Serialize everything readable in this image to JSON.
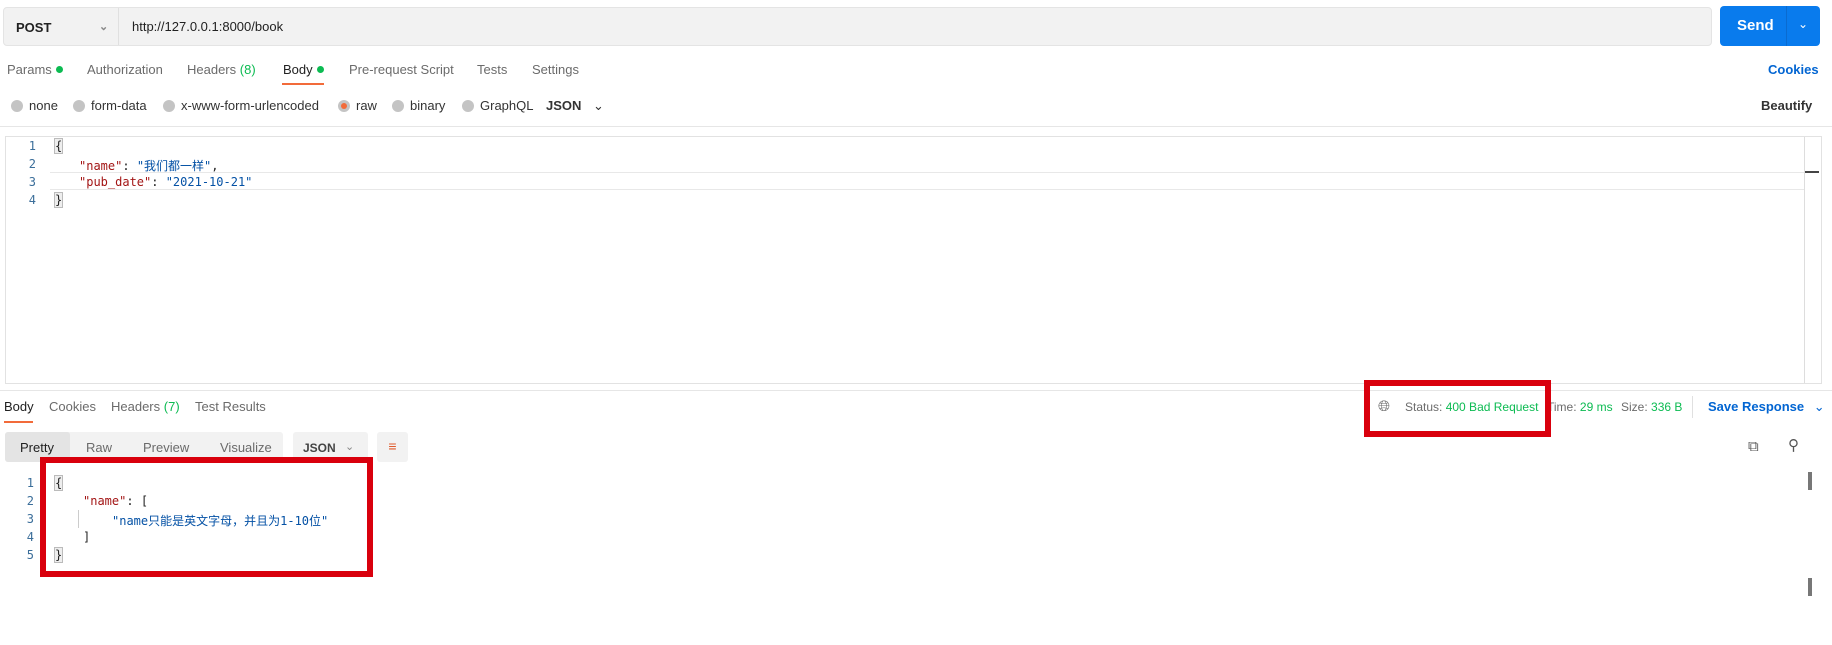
{
  "request": {
    "method": "POST",
    "url": "http://127.0.0.1:8000/book",
    "send_label": "Send"
  },
  "tabs": [
    {
      "label": "Params",
      "dot": true
    },
    {
      "label": "Authorization"
    },
    {
      "label": "Headers",
      "count": "(8)"
    },
    {
      "label": "Body",
      "dot": true,
      "active": true
    },
    {
      "label": "Pre-request Script"
    },
    {
      "label": "Tests"
    },
    {
      "label": "Settings"
    }
  ],
  "cookies_label": "Cookies",
  "body_types": [
    {
      "label": "none"
    },
    {
      "label": "form-data"
    },
    {
      "label": "x-www-form-urlencoded"
    },
    {
      "label": "raw",
      "selected": true
    },
    {
      "label": "binary"
    },
    {
      "label": "GraphQL"
    }
  ],
  "body_format": "JSON",
  "beautify_label": "Beautify",
  "request_body": {
    "line_numbers": [
      "1",
      "2",
      "3",
      "4"
    ],
    "open": "{",
    "close": "}",
    "k1": "\"name\"",
    "v1": "\"我们都一样\"",
    "k2": "\"pub_date\"",
    "v2": "\"2021-10-21\""
  },
  "response": {
    "tabs": [
      {
        "label": "Body",
        "active": true
      },
      {
        "label": "Cookies"
      },
      {
        "label": "Headers",
        "count": "(7)"
      },
      {
        "label": "Test Results"
      }
    ],
    "status_label": "Status:",
    "status_value": "400 Bad Request",
    "time_label": "Time:",
    "time_value": "29 ms",
    "size_label": "Size:",
    "size_value": "336 B",
    "save_label": "Save Response",
    "view_tabs": [
      "Pretty",
      "Raw",
      "Preview",
      "Visualize"
    ],
    "format": "JSON",
    "line_numbers": [
      "1",
      "2",
      "3",
      "4",
      "5"
    ],
    "open": "{",
    "key": "\"name\"",
    "arr_open": "[",
    "message": "\"name只能是英文字母，并且为1-10位\"",
    "arr_close": "]",
    "close": "}"
  },
  "colors": {
    "accent": "#097bed",
    "active_tab": "#f26b3a",
    "status_ok": "#0cbb52",
    "highlight": "#d9000d"
  }
}
